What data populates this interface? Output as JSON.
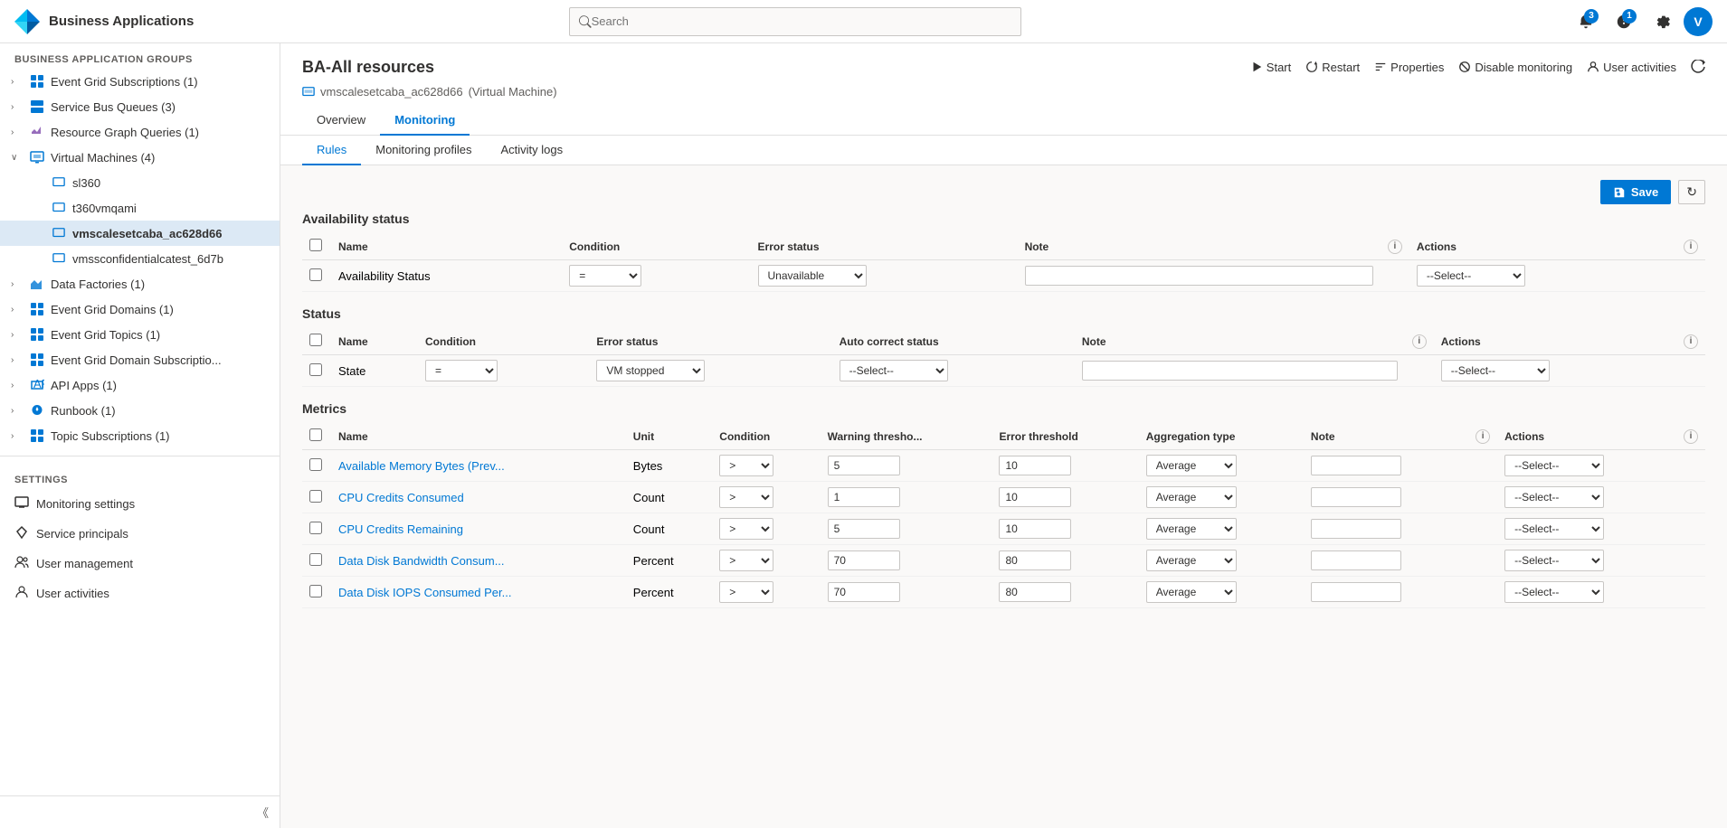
{
  "topbar": {
    "title": "Business Applications",
    "search_placeholder": "Search",
    "notifications_count": "3",
    "alerts_count": "1",
    "avatar_letter": "V"
  },
  "sidebar": {
    "section_header": "BUSINESS APPLICATION GROUPS",
    "groups": [
      {
        "label": "Event Grid Subscriptions (1)",
        "icon": "grid",
        "expanded": false
      },
      {
        "label": "Service Bus Queues (3)",
        "icon": "bus",
        "expanded": false
      },
      {
        "label": "Resource Graph Queries (1)",
        "icon": "graph",
        "expanded": false
      },
      {
        "label": "Virtual Machines (4)",
        "icon": "vm",
        "expanded": true
      }
    ],
    "vm_children": [
      {
        "label": "sl360",
        "active": false
      },
      {
        "label": "t360vmqami",
        "active": false
      },
      {
        "label": "vmscalesetcaba_ac628d66",
        "active": true
      },
      {
        "label": "vmssconfidentialcatest_6d7b",
        "active": false
      }
    ],
    "more_groups": [
      {
        "label": "Data Factories (1)",
        "icon": "factory"
      },
      {
        "label": "Event Grid Domains (1)",
        "icon": "grid"
      },
      {
        "label": "Event Grid Topics (1)",
        "icon": "grid"
      },
      {
        "label": "Event Grid Domain Subscriptio...",
        "icon": "grid"
      },
      {
        "label": "API Apps (1)",
        "icon": "api"
      },
      {
        "label": "Runbook (1)",
        "icon": "runbook"
      },
      {
        "label": "Topic Subscriptions (1)",
        "icon": "topic"
      }
    ],
    "settings_header": "SETTINGS",
    "settings_items": [
      {
        "label": "Monitoring settings",
        "icon": "monitor"
      },
      {
        "label": "Service principals",
        "icon": "diamond"
      },
      {
        "label": "User management",
        "icon": "users"
      },
      {
        "label": "User activities",
        "icon": "activity"
      }
    ],
    "collapse_label": "Collapse"
  },
  "resource": {
    "title": "BA-All resources",
    "subtitle_icon": "vm-icon",
    "subtitle_name": "vmscalesetcaba_ac628d66",
    "subtitle_type": "(Virtual Machine)",
    "actions": [
      {
        "label": "Start",
        "icon": "play"
      },
      {
        "label": "Restart",
        "icon": "restart"
      },
      {
        "label": "Properties",
        "icon": "properties"
      },
      {
        "label": "Disable monitoring",
        "icon": "disable"
      },
      {
        "label": "User activities",
        "icon": "user-act"
      },
      {
        "label": "refresh",
        "icon": "refresh"
      }
    ]
  },
  "tabs": {
    "items": [
      "Overview",
      "Monitoring"
    ],
    "active": "Monitoring"
  },
  "sub_tabs": {
    "items": [
      "Rules",
      "Monitoring profiles",
      "Activity logs"
    ],
    "active": "Rules"
  },
  "availability_section": {
    "title": "Availability status",
    "columns": [
      "Name",
      "Condition",
      "Error status",
      "Note",
      "",
      "Actions",
      ""
    ],
    "rows": [
      {
        "name": "Availability Status",
        "condition": "=",
        "error_status": "Unavailable",
        "note": "",
        "actions": "--Select--"
      }
    ]
  },
  "status_section": {
    "title": "Status",
    "columns": [
      "Name",
      "Condition",
      "Error status",
      "Auto correct status",
      "Note",
      "",
      "Actions",
      ""
    ],
    "rows": [
      {
        "name": "State",
        "condition": "=",
        "error_status": "VM stopped",
        "auto_correct": "--Select--",
        "note": "",
        "actions": "--Select--"
      }
    ]
  },
  "metrics_section": {
    "title": "Metrics",
    "columns": [
      "Name",
      "Unit",
      "Condition",
      "Warning thresho...",
      "Error threshold",
      "Aggregation type",
      "Note",
      "",
      "Actions",
      ""
    ],
    "rows": [
      {
        "name": "Available Memory Bytes (Prev...",
        "unit": "Bytes",
        "condition": ">",
        "warning": "5",
        "error": "10",
        "aggregation": "Average",
        "note": "",
        "actions": "--Select--"
      },
      {
        "name": "CPU Credits Consumed",
        "unit": "Count",
        "condition": ">",
        "warning": "1",
        "error": "10",
        "aggregation": "Average",
        "note": "",
        "actions": "--Select--"
      },
      {
        "name": "CPU Credits Remaining",
        "unit": "Count",
        "condition": ">",
        "warning": "5",
        "error": "10",
        "aggregation": "Average",
        "note": "",
        "actions": "--Select--"
      },
      {
        "name": "Data Disk Bandwidth Consum...",
        "unit": "Percent",
        "condition": ">",
        "warning": "70",
        "error": "80",
        "aggregation": "Average",
        "note": "",
        "actions": "--Select--"
      },
      {
        "name": "Data Disk IOPS Consumed Per...",
        "unit": "Percent",
        "condition": ">",
        "warning": "70",
        "error": "80",
        "aggregation": "Average",
        "note": "",
        "actions": "--Select--"
      }
    ]
  },
  "buttons": {
    "save": "Save",
    "refresh": "↻"
  }
}
